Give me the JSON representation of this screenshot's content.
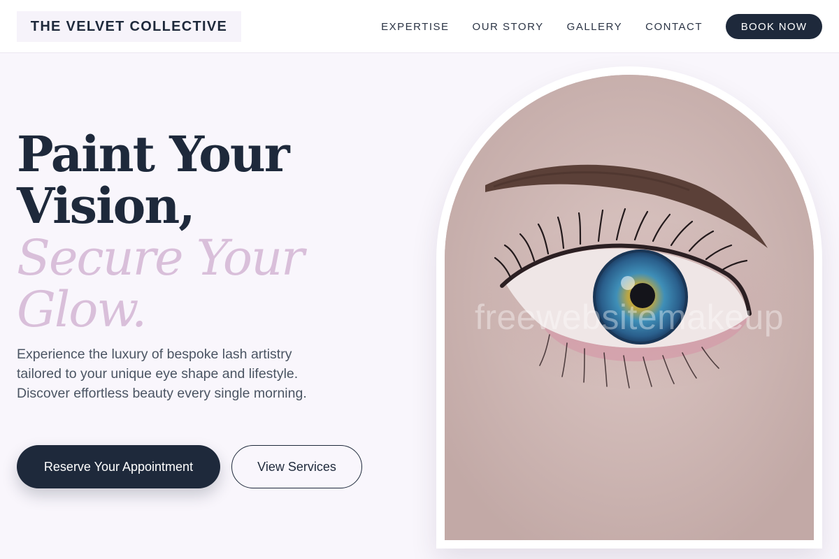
{
  "header": {
    "brand": "THE VELVET COLLECTIVE",
    "nav": [
      {
        "label": "EXPERTISE"
      },
      {
        "label": "OUR STORY"
      },
      {
        "label": "GALLERY"
      },
      {
        "label": "CONTACT"
      }
    ],
    "cta": "BOOK NOW"
  },
  "hero": {
    "headline_line1": "Paint Your",
    "headline_line2": "Vision,",
    "accent_line1": "Secure Your",
    "accent_line2": "Glow.",
    "description": "Experience the luxury of bespoke lash artistry tailored to your unique eye shape and lifestyle. Discover effortless beauty every single morning.",
    "primary_button": "Reserve Your Appointment",
    "secondary_button": "View Services"
  },
  "image": {
    "watermark": "freewebsitemakeup"
  },
  "colors": {
    "navy": "#1e293b",
    "accent_mauve": "#d9bfda",
    "background": "#f9f6fc",
    "body_text": "#4b5563"
  }
}
